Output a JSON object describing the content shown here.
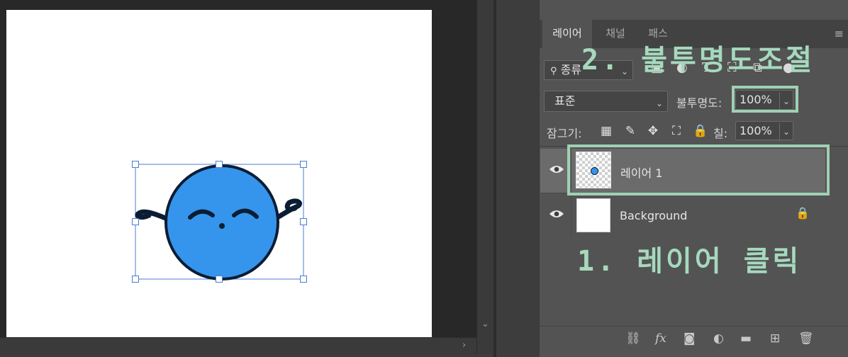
{
  "layers_panel": {
    "tabs": [
      "레이어",
      "채널",
      "패스"
    ],
    "menu_icon": "panel-menu-icon",
    "filter": {
      "kind_label": "종류",
      "search_icon": "🔍"
    },
    "blend_mode": "표준",
    "opacity_label": "불투명도:",
    "opacity_value": "100%",
    "lock_label": "잠그기:",
    "fill_label": "칠:",
    "fill_value": "100%",
    "layers": [
      {
        "name": "레이어 1",
        "visible": true,
        "selected": true
      },
      {
        "name": "Background",
        "visible": true,
        "locked": true
      }
    ],
    "bottom_icons": [
      "link-icon",
      "fx-icon",
      "mask-icon",
      "adjustment-icon",
      "folder-icon",
      "new-layer-icon",
      "trash-icon"
    ]
  },
  "annotations": {
    "step1": "1. 레이어 클릭",
    "step2": "2. 불투명도조절"
  },
  "colors": {
    "annotation": "#a6d9bd",
    "character_fill": "#3595ec",
    "character_stroke": "#0b1d33",
    "selection": "#4a7cd6"
  }
}
